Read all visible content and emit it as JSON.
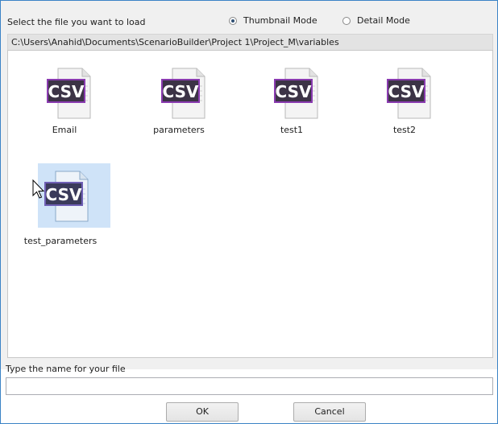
{
  "dialog": {
    "prompt": "Select the file you want to load",
    "view_modes": [
      {
        "label": "Thumbnail Mode",
        "selected": true
      },
      {
        "label": "Detail Mode",
        "selected": false
      }
    ],
    "path": "C:\\Users\\Anahid\\Documents\\ScenarioBuilder\\Project 1\\Project_M\\variables",
    "files": [
      {
        "name": "Email",
        "type": "CSV",
        "selected": false
      },
      {
        "name": "parameters",
        "type": "CSV",
        "selected": false
      },
      {
        "name": "test1",
        "type": "CSV",
        "selected": false
      },
      {
        "name": "test2",
        "type": "CSV",
        "selected": false
      },
      {
        "name": "test_parameters",
        "type": "CSV",
        "selected": true
      }
    ],
    "name_label": "Type the name for your file",
    "name_value": "",
    "ok_label": "OK",
    "cancel_label": "Cancel"
  },
  "icons": {
    "file": "csv-file-icon",
    "radio": "radio-button",
    "cursor": "mouse-pointer-icon"
  },
  "colors": {
    "selection": "#cfe3f8",
    "window_border": "#3b83c6",
    "csv_badge": "#3c3346",
    "csv_badge_border": "#8a3bb0"
  }
}
